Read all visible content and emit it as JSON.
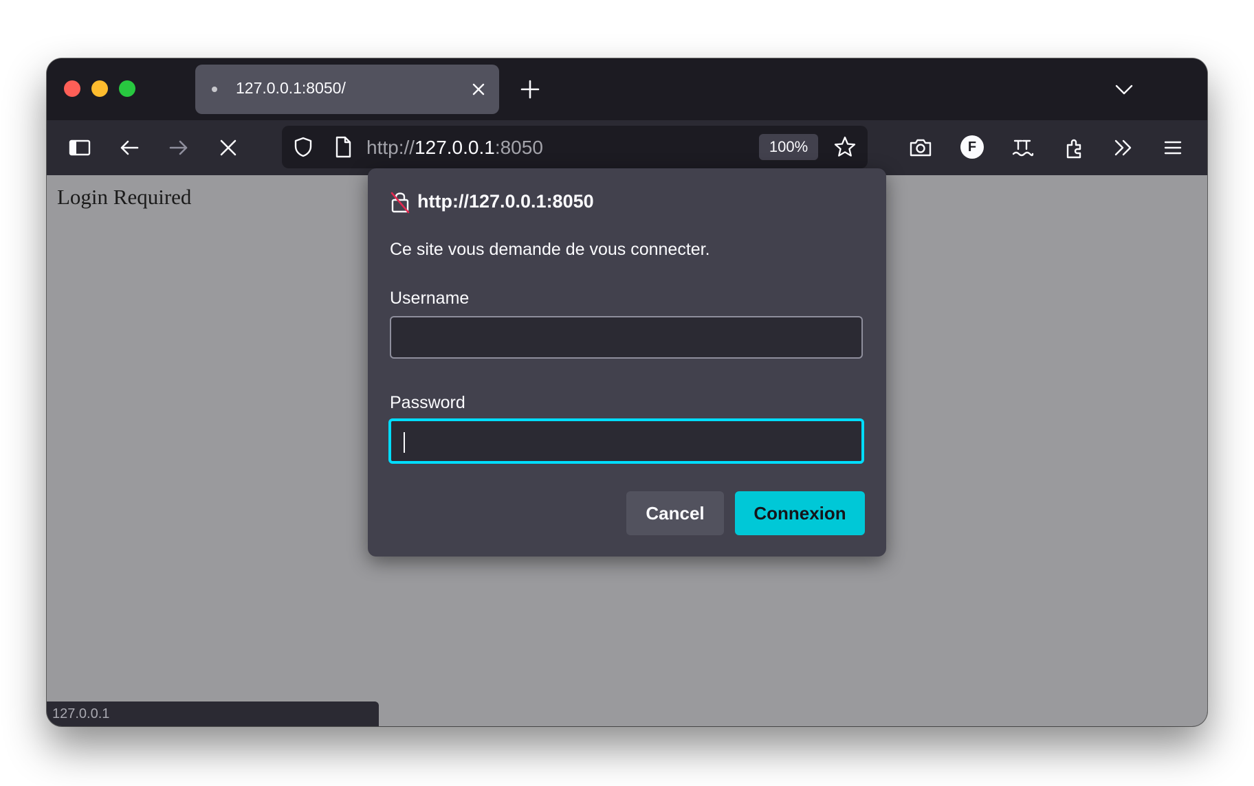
{
  "browser": {
    "tab": {
      "title": "127.0.0.1:8050/"
    },
    "url": {
      "scheme": "http://",
      "host": "127.0.0.1",
      "port": ":8050"
    },
    "zoom": "100%",
    "profile_initial": "F",
    "status_text": "127.0.0.1"
  },
  "page": {
    "heading": "Login Required"
  },
  "auth_dialog": {
    "origin": "http://127.0.0.1:8050",
    "message": "Ce site vous demande de vous connecter.",
    "username_label": "Username",
    "username_value": "",
    "password_label": "Password",
    "password_value": "",
    "cancel_label": "Cancel",
    "submit_label": "Connexion"
  },
  "colors": {
    "accent": "#00ddff",
    "submit_button": "#00c8d7",
    "dialog_bg": "#42414d",
    "toolbar_bg": "#2b2a33"
  },
  "icons": [
    "sidebar-icon",
    "back-icon",
    "forward-icon",
    "stop-icon",
    "shield-icon",
    "page-icon",
    "star-icon",
    "screenshot-icon",
    "translate-icon",
    "extensions-icon",
    "overflow-icon",
    "menu-icon",
    "lock-insecure-icon",
    "close-icon",
    "plus-icon",
    "chevron-down-icon"
  ]
}
